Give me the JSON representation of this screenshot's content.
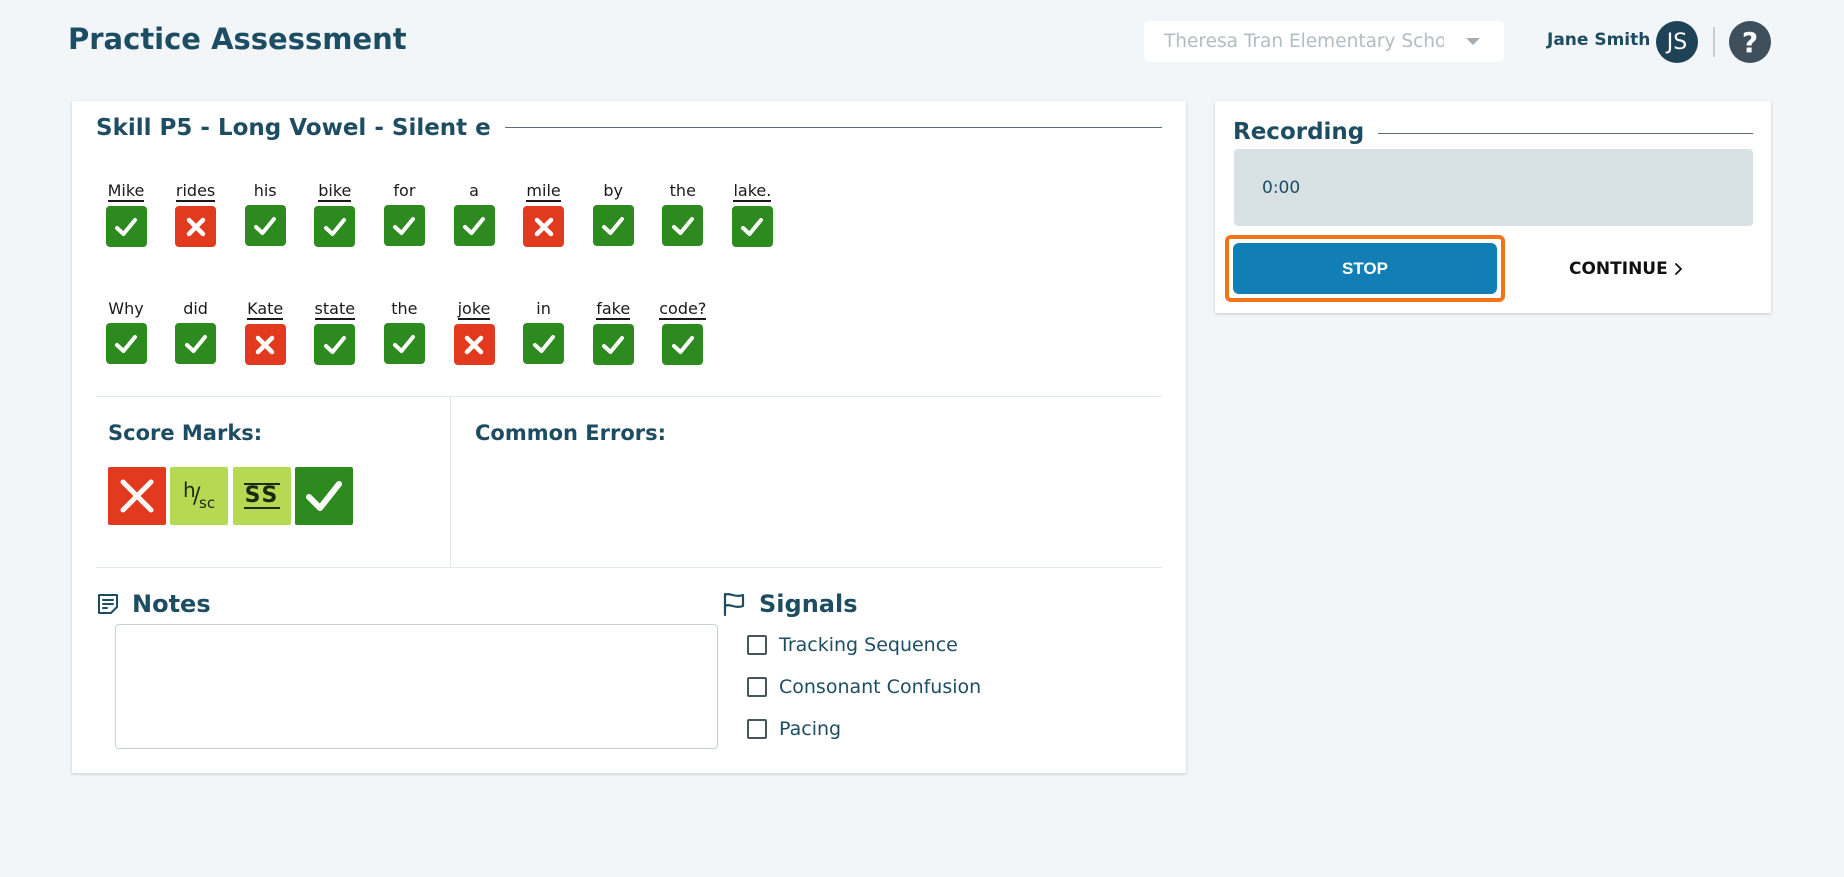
{
  "header": {
    "title": "Practice Assessment",
    "school": "Theresa Tran Elementary School",
    "user_name": "Jane Smith",
    "avatar_initials": "JS",
    "help_symbol": "?"
  },
  "skill": {
    "title": "Skill P5 - Long Vowel - Silent e",
    "row1": [
      {
        "word": "Mike",
        "underlined": true,
        "correct": true
      },
      {
        "word": "rides",
        "underlined": true,
        "correct": false
      },
      {
        "word": "his",
        "underlined": false,
        "correct": true
      },
      {
        "word": "bike",
        "underlined": true,
        "correct": true
      },
      {
        "word": "for",
        "underlined": false,
        "correct": true
      },
      {
        "word": "a",
        "underlined": false,
        "correct": true
      },
      {
        "word": "mile",
        "underlined": true,
        "correct": false
      },
      {
        "word": "by",
        "underlined": false,
        "correct": true
      },
      {
        "word": "the",
        "underlined": false,
        "correct": true
      },
      {
        "word": "lake.",
        "underlined": true,
        "correct": true
      }
    ],
    "row2": [
      {
        "word": "Why",
        "underlined": false,
        "correct": true
      },
      {
        "word": "did",
        "underlined": false,
        "correct": true
      },
      {
        "word": "Kate",
        "underlined": true,
        "correct": false
      },
      {
        "word": "state",
        "underlined": true,
        "correct": true
      },
      {
        "word": "the",
        "underlined": false,
        "correct": true
      },
      {
        "word": "joke",
        "underlined": true,
        "correct": false
      },
      {
        "word": "in",
        "underlined": false,
        "correct": true
      },
      {
        "word": "fake",
        "underlined": true,
        "correct": true
      },
      {
        "word": "code?",
        "underlined": true,
        "correct": true
      }
    ]
  },
  "score_marks": {
    "label": "Score Marks:",
    "hsc_top": "h",
    "hsc_bottom": "sc",
    "ss_label": "SS"
  },
  "common_errors": {
    "label": "Common Errors:"
  },
  "notes": {
    "label": "Notes",
    "value": ""
  },
  "signals": {
    "label": "Signals",
    "items": [
      "Tracking Sequence",
      "Consonant Confusion",
      "Pacing"
    ]
  },
  "recording": {
    "title": "Recording",
    "time": "0:00",
    "stop_label": "STOP",
    "continue_label": "CONTINUE"
  },
  "colors": {
    "correct": "#2d8a1e",
    "error": "#e23a1e",
    "partial": "#b5d953",
    "primary": "#117fb6",
    "highlight": "#f37319",
    "heading": "#1d4d62"
  }
}
